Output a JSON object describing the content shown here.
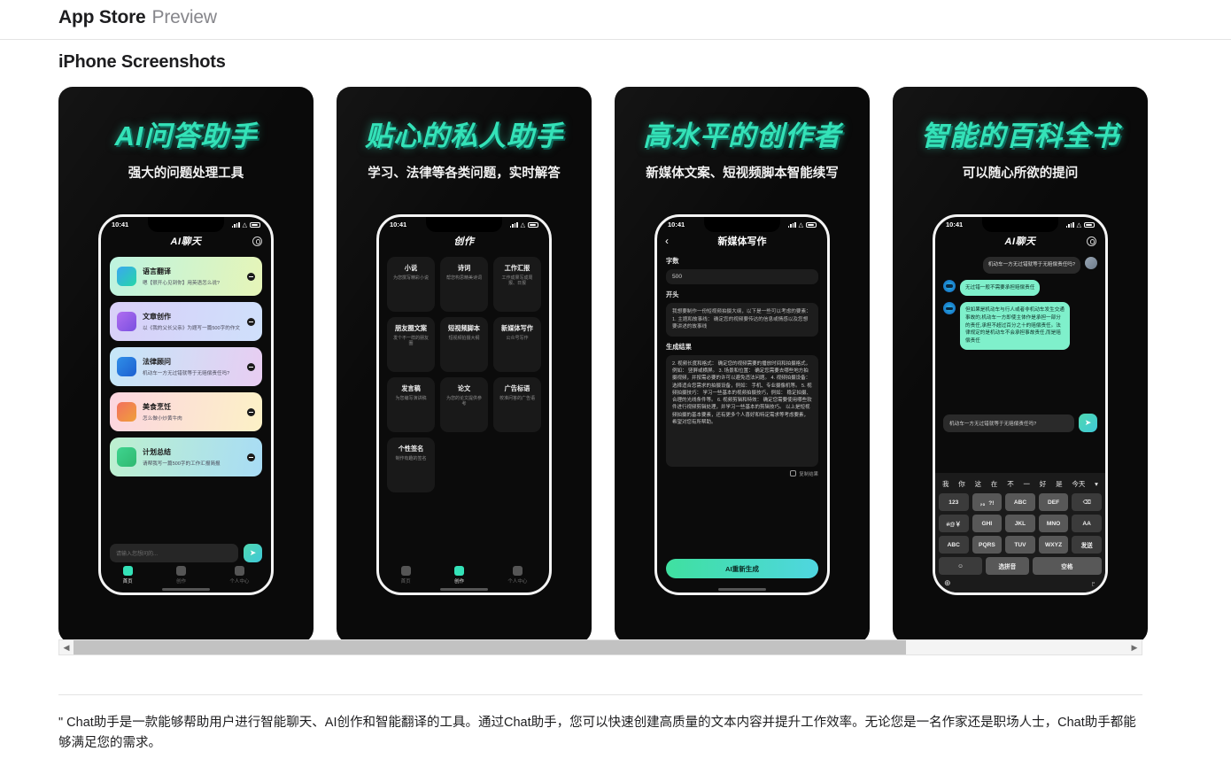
{
  "header": {
    "title": "App Store",
    "subtitle": "Preview"
  },
  "section": {
    "title": "iPhone Screenshots"
  },
  "scrollbar": {
    "left_arrow": "◀",
    "right_arrow": "▶"
  },
  "description": "\" Chat助手是一款能够帮助用户进行智能聊天、AI创作和智能翻译的工具。通过Chat助手，您可以快速创建高质量的文本内容并提升工作效率。无论您是一名作家还是职场人士，Chat助手都能够满足您的需求。",
  "colors": {
    "accent_green": "#34e2b8",
    "bubble_ai": "#7ff0cb",
    "panel_bg": "#0a0a0a"
  },
  "shots": [
    {
      "headline": "AI问答助手",
      "subtitle": "强大的问题处理工具",
      "phone": {
        "time": "10:41",
        "nav_title": "AI聊天",
        "cards": [
          {
            "title": "语言翻译",
            "desc": "嗯【很开心见到你】用英语怎么说?"
          },
          {
            "title": "文章创作",
            "desc": "以《我的父长父亲》为题写一篇500字的作文"
          },
          {
            "title": "法律顾问",
            "desc": "机动车一方无过错就等于无赔偿责任吗?"
          },
          {
            "title": "美食烹饪",
            "desc": "怎么做小炒黄牛肉"
          },
          {
            "title": "计划总结",
            "desc": "请帮我写一篇500字的工作汇报简报"
          }
        ],
        "composer_placeholder": "请输入您想问的...",
        "tabs": [
          {
            "label": "首页",
            "active": true
          },
          {
            "label": "创作",
            "active": false
          },
          {
            "label": "个人中心",
            "active": false
          }
        ]
      }
    },
    {
      "headline": "贴心的私人助手",
      "subtitle": "学习、法律等各类问题，实时解答",
      "phone": {
        "time": "10:41",
        "nav_title": "创作",
        "grid": [
          {
            "title": "小说",
            "desc": "为您撰写精彩小说"
          },
          {
            "title": "诗词",
            "desc": "帮您构思精美诗词"
          },
          {
            "title": "工作汇报",
            "desc": "工作成果写成周报、日报"
          },
          {
            "title": "朋友圈文案",
            "desc": "发个不一样的朋友圈"
          },
          {
            "title": "短视频脚本",
            "desc": "短视频拍摄大纲"
          },
          {
            "title": "新媒体写作",
            "desc": "公众号写作"
          },
          {
            "title": "发言稿",
            "desc": "为您编写演讲稿"
          },
          {
            "title": "论文",
            "desc": "为您的论文提供参考"
          },
          {
            "title": "广告标语",
            "desc": "校准问答的广告语"
          },
          {
            "title": "个性签名",
            "desc": "制作有趣的签名"
          }
        ],
        "tabs": [
          {
            "label": "首页",
            "active": false
          },
          {
            "label": "创作",
            "active": true
          },
          {
            "label": "个人中心",
            "active": false
          }
        ]
      }
    },
    {
      "headline": "高水平的创作者",
      "subtitle": "新媒体文案、短视频脚本智能续写",
      "phone": {
        "time": "10:41",
        "nav_title": "新媒体写作",
        "back_icon": "‹",
        "word_count_label": "字数",
        "word_count_value": "500",
        "opening_label": "开头",
        "opening_text": "我想要制作一份短视频拍摄大纲，以下是一些可以考虑的要素： 1. 主题和故事线： 确定您的视频要传达的信息或情感以及您想要讲述的故事线",
        "result_label": "生成结果",
        "result_text": "2. 视频长度和格式： 确定您的视频需要的播放时间和拍摄格式，例如： 竖屏或横屏。 3. 场景和位置： 确定您需要去哪些地方拍摄视频，并按需必要的许可以避免违法问题。 4. 视频拍摄设备： 选择适合您需求的拍摄设备，例如： 手机、专业摄像机等。 5. 视频拍摄技巧： 学习一些基本的视频拍摄技巧，例如： 稳定拍摄、合理的光线条件等。 6. 视频剪辑和特效： 确定您需要使用哪些软件进行视频剪辑处理，并学习一些基本的剪辑技巧。 以上是短视频拍摄的基本要素，还有更多个人喜好和特定需求等考虑要素，希望对您有所帮助。",
        "copy_label": "复制结果",
        "regen_label": "AI重新生成"
      }
    },
    {
      "headline": "智能的百科全书",
      "subtitle": "可以随心所欲的提问",
      "phone": {
        "time": "10:41",
        "nav_title": "AI聊天",
        "messages": [
          {
            "from": "user",
            "text": "机动车一方无过错就等于无赔偿责任吗?"
          },
          {
            "from": "ai",
            "text": "无过错一般不需要承担赔偿责任"
          },
          {
            "from": "ai",
            "text": "但如果是机动车与行人或者非机动车发生交通事故的,机动车一方即使主体作是承担一部分的责任,承担不超过百分之十的赔偿责任。法律规定的是机动车不会承担事故责任,而是赔偿责任"
          }
        ],
        "input_value": "机动车一方无过错就等于无赔偿责任吗?",
        "keyboard": {
          "suggestions": [
            "我",
            "你",
            "这",
            "在",
            "不",
            "一",
            "好",
            "是",
            "今天"
          ],
          "rows": [
            [
              "123",
              "，。?!",
              "ABC",
              "DEF",
              "⌫"
            ],
            [
              "#@￥",
              "GHI",
              "JKL",
              "MNO",
              "AA"
            ],
            [
              "ABC",
              "PQRS",
              "TUV",
              "WXYZ",
              "发送"
            ],
            [
              "☺",
              "选拼音",
              "空格"
            ]
          ],
          "globe_icon": "⊕",
          "mic_icon": "♇"
        }
      }
    }
  ]
}
